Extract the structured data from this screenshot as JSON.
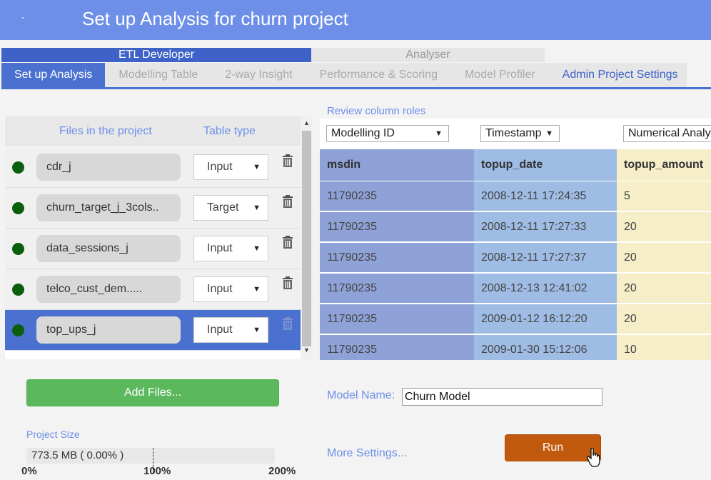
{
  "header": {
    "title": "Set up Analysis for churn project"
  },
  "roles": {
    "etl": "ETL Developer",
    "analyser": "Analyser"
  },
  "tabs": [
    {
      "label": "Set up Analysis"
    },
    {
      "label": "Modelling Table"
    },
    {
      "label": "2-way Insight"
    },
    {
      "label": "Performance & Scoring"
    },
    {
      "label": "Model Profiler"
    },
    {
      "label": "Admin Project Settings"
    }
  ],
  "files": {
    "header_name": "Files in the project",
    "header_type": "Table type",
    "rows": [
      {
        "name": "cdr_j",
        "type": "Input"
      },
      {
        "name": "churn_target_j_3cols..",
        "type": "Target"
      },
      {
        "name": "data_sessions_j",
        "type": "Input"
      },
      {
        "name": "telco_cust_dem.....",
        "type": "Input"
      },
      {
        "name": "top_ups_j",
        "type": "Input"
      }
    ],
    "status_color": "#0b5e0b",
    "selected_color": "#4a70d0"
  },
  "review": {
    "label": "Review column roles",
    "columns": [
      {
        "role": "Modelling ID",
        "header": "msdin",
        "color": "#8fa2d8"
      },
      {
        "role": "Timestamp",
        "header": "topup_date",
        "color": "#9fbce4"
      },
      {
        "role": "Numerical Analy",
        "header": "topup_amount",
        "color": "#f5eec8"
      }
    ],
    "rows": [
      [
        "11790235",
        "2008-12-11 17:24:35",
        "5"
      ],
      [
        "11790235",
        "2008-12-11 17:27:33",
        "20"
      ],
      [
        "11790235",
        "2008-12-11 17:27:37",
        "20"
      ],
      [
        "11790235",
        "2008-12-13 12:41:02",
        "20"
      ],
      [
        "11790235",
        "2009-01-12 16:12:20",
        "20"
      ],
      [
        "11790235",
        "2009-01-30 15:12:06",
        "10"
      ]
    ]
  },
  "add_files": {
    "label": "Add Files..."
  },
  "project_size": {
    "label": "Project Size",
    "value": "773.5 MB ( 0.00% )",
    "ticks": [
      "0%",
      "100%",
      "200%"
    ]
  },
  "model": {
    "label": "Model Name:",
    "value": "Churn Model"
  },
  "more_settings": "More Settings...",
  "run": {
    "label": "Run"
  },
  "colors": {
    "accent": "#4a70d0",
    "header": "#6d8fe8",
    "run": "#c15a0c",
    "add": "#5cb85c"
  }
}
